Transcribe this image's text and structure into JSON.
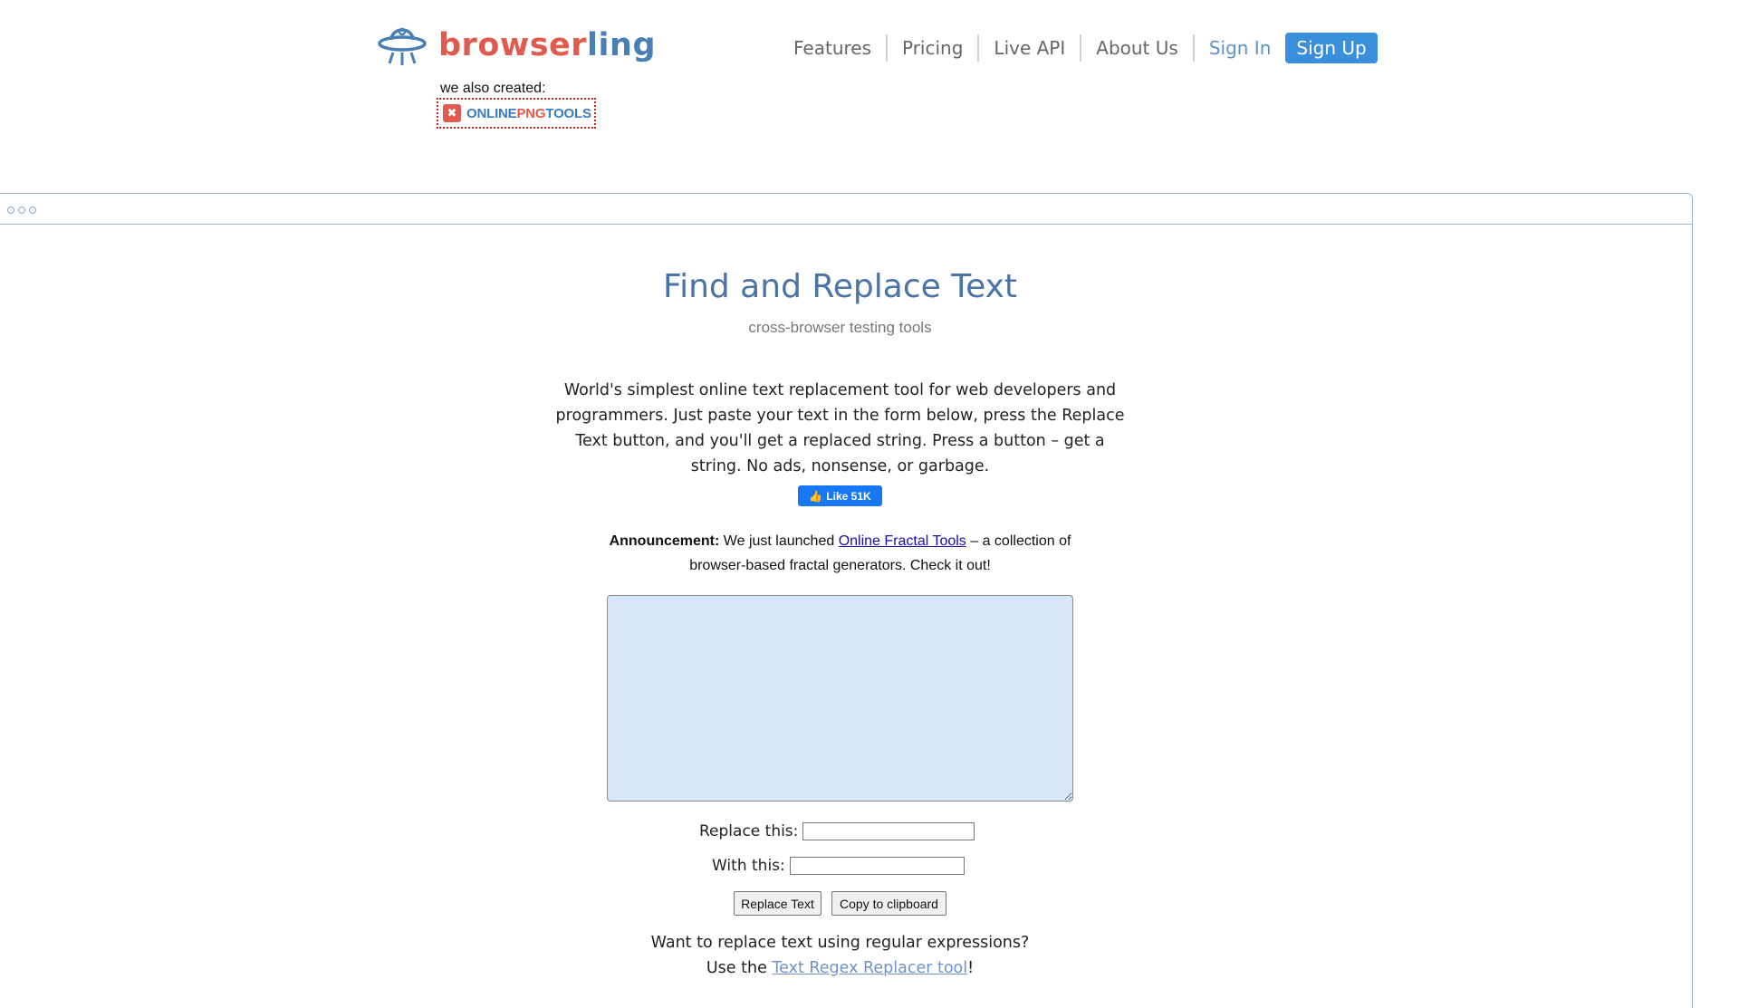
{
  "header": {
    "logo_part1": "browser",
    "logo_part2": "ling",
    "nav": [
      "Features",
      "Pricing",
      "Live API",
      "About Us"
    ],
    "sign_in": "Sign In",
    "sign_up": "Sign Up",
    "also_created": "we also created:",
    "png_tools": {
      "part1": "ONLINE",
      "part2": "PNG",
      "part3": "TOOLS"
    }
  },
  "main": {
    "title": "Find and Replace Text",
    "subtitle": "cross-browser testing tools",
    "description": "World's simplest online text replacement tool for web developers and programmers. Just paste your text in the form below, press the Replace Text button, and you'll get a replaced string. Press a button – get a string. No ads, nonsense, or garbage.",
    "like_label": "Like 51K",
    "announcement": {
      "label": "Announcement:",
      "text_before": " We just launched ",
      "link": "Online Fractal Tools",
      "text_after": " – a collection of browser-based fractal generators. Check it out!"
    },
    "textarea_value": "",
    "replace_this_label": "Replace this:",
    "replace_this_value": "",
    "with_this_label": "With this:",
    "with_this_value": "",
    "replace_button": "Replace Text",
    "copy_button": "Copy to clipboard",
    "regex_line1": "Want to replace text using regular expressions?",
    "regex_before": "Use the ",
    "regex_link": "Text Regex Replacer tool",
    "regex_after": "!"
  },
  "colors": {
    "accent_red": "#e05a4e",
    "accent_blue": "#4a7fb6",
    "textarea_bg": "#d7e7fc",
    "signup_bg": "#3a8fdc"
  }
}
